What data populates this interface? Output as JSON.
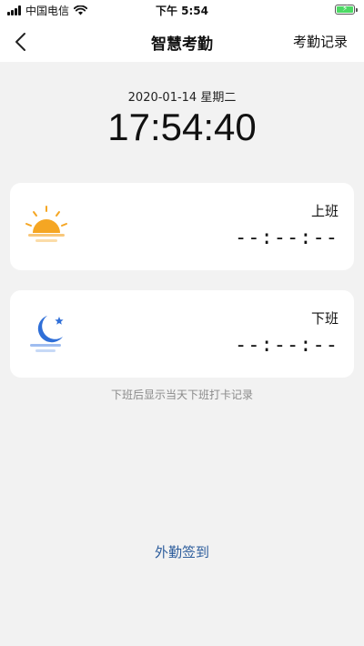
{
  "status_bar": {
    "carrier": "中国电信",
    "time": "下午 5:54",
    "icons": [
      "signal-icon",
      "wifi-icon",
      "battery-charging-icon"
    ]
  },
  "nav": {
    "title": "智慧考勤",
    "action_label": "考勤记录",
    "back_icon": "chevron-left-icon"
  },
  "datetime": {
    "date": "2020-01-14 星期二",
    "clock": "17:54:40"
  },
  "cards": [
    {
      "label": "上班",
      "time": "--:--:--",
      "icon": "sunrise-icon",
      "accent": "#f5a623"
    },
    {
      "label": "下班",
      "time": "--:--:--",
      "icon": "moon-icon",
      "accent": "#2f6fd8"
    }
  ],
  "hint": "下班后显示当天下班打卡记录",
  "outside_signin_label": "外勤签到"
}
